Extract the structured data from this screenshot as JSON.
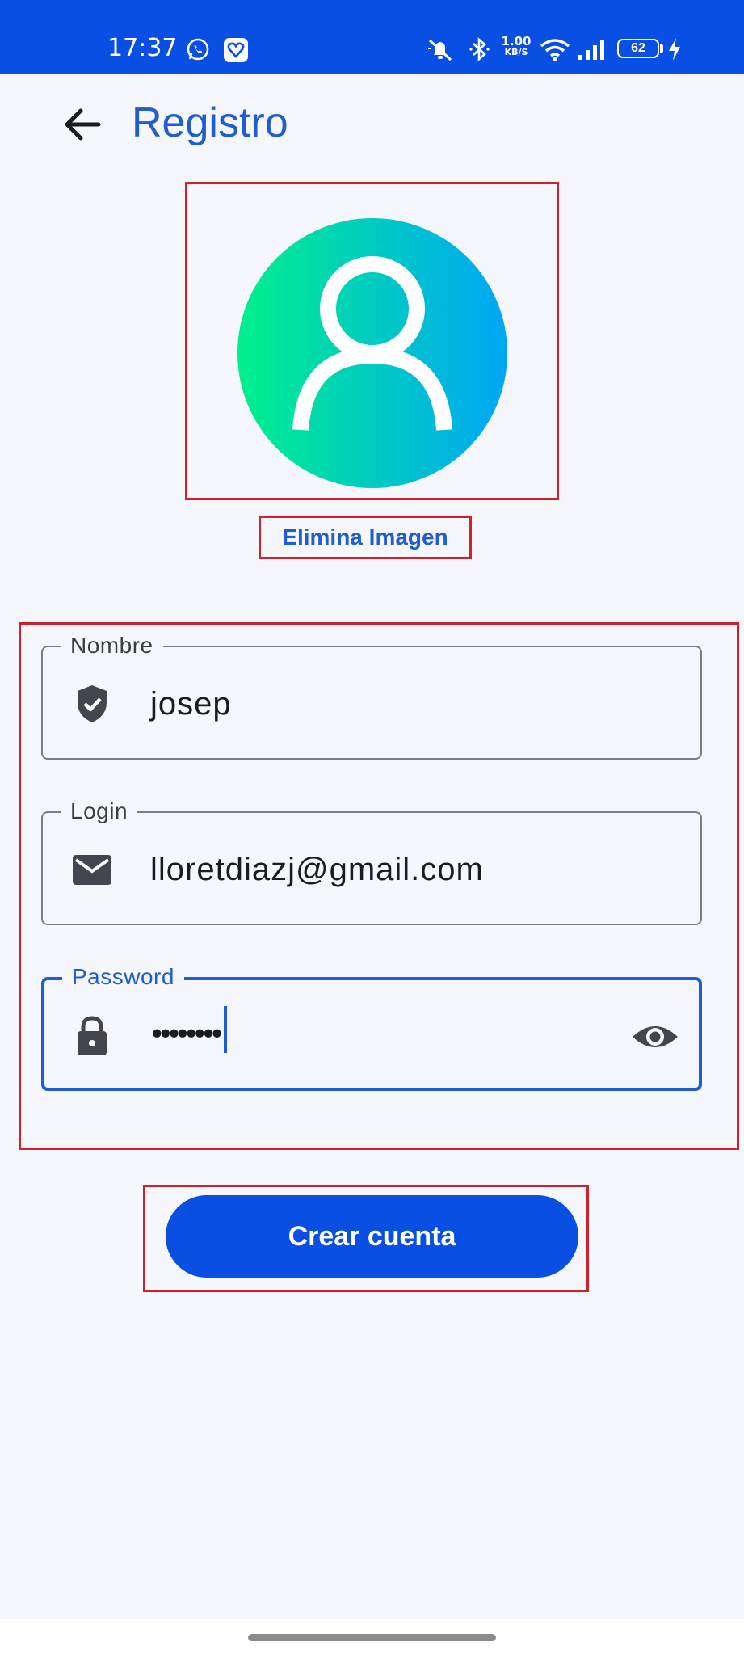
{
  "status_bar": {
    "time": "17:37",
    "net_speed_value": "1.00",
    "net_speed_unit": "KB/S",
    "battery_level": "62"
  },
  "header": {
    "title": "Registro",
    "back_icon": "arrow-left-icon"
  },
  "avatar": {
    "icon": "person-icon",
    "gradient_start": "#00f08c",
    "gradient_end": "#00a6f5"
  },
  "remove_image_label": "Elimina Imagen",
  "form": {
    "fields": [
      {
        "label": "Nombre",
        "value": "josep",
        "icon": "shield-check-icon"
      },
      {
        "label": "Login",
        "value": "lloretdiazj@gmail.com",
        "icon": "email-icon"
      },
      {
        "label": "Password",
        "value": "••••••••",
        "icon": "lock-icon",
        "trailing_icon": "eye-icon",
        "focused": true
      }
    ]
  },
  "submit_label": "Crear cuenta",
  "colors": {
    "primary": "#0a4fe3",
    "accent_text": "#1f5dd0",
    "highlight_box": "#d0202a",
    "background": "#f5f7fc"
  }
}
